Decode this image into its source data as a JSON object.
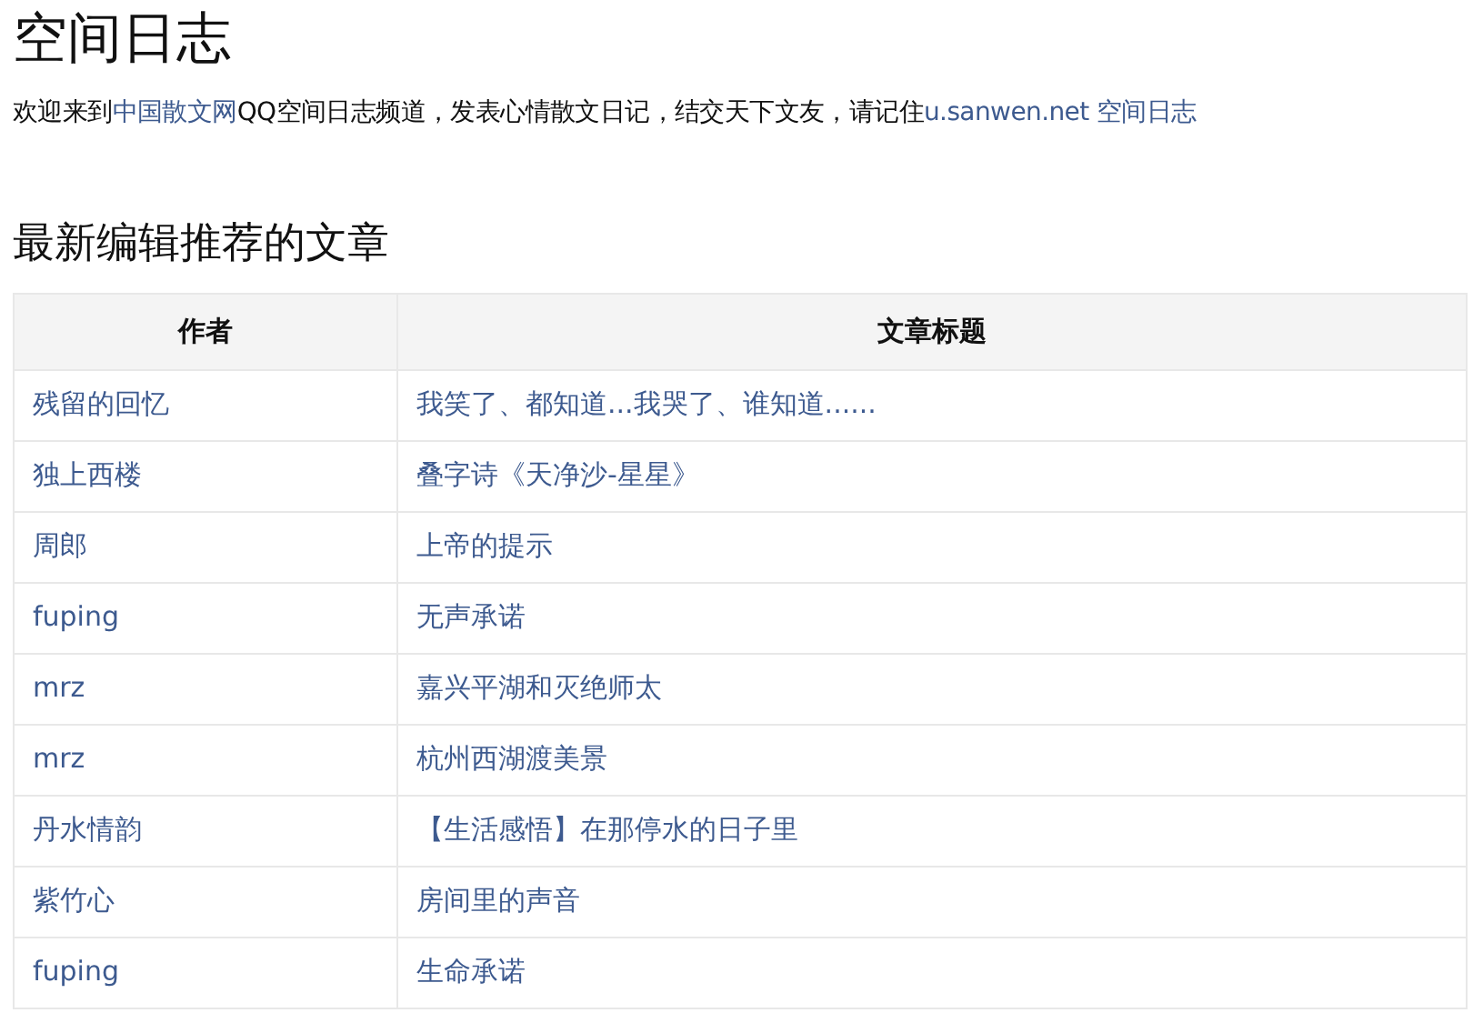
{
  "title": "空间日志",
  "intro": [
    {
      "kind": "text",
      "text": "欢迎来到"
    },
    {
      "kind": "link",
      "text": "中国散文网"
    },
    {
      "kind": "text",
      "text": "QQ空间日志频道，发表心情散文日记，结交天下文友，请记住"
    },
    {
      "kind": "link",
      "text": "u.sanwen.net 空间日志"
    }
  ],
  "section_title": "最新编辑推荐的文章",
  "table": {
    "columns": [
      "作者",
      "文章标题"
    ],
    "rows": [
      [
        "残留的回忆",
        "我笑了、都知道...我哭了、谁知道......"
      ],
      [
        "独上西楼",
        "叠字诗《天净沙-星星》"
      ],
      [
        "周郎",
        "上帝的提示"
      ],
      [
        "fuping",
        "无声承诺"
      ],
      [
        "mrz",
        "嘉兴平湖和灭绝师太"
      ],
      [
        "mrz",
        "杭州西湖渡美景"
      ],
      [
        "丹水情韵",
        "【生活感悟】在那停水的日子里"
      ],
      [
        "紫竹心",
        "房间里的声音"
      ],
      [
        "fuping",
        "生命承诺"
      ]
    ]
  }
}
